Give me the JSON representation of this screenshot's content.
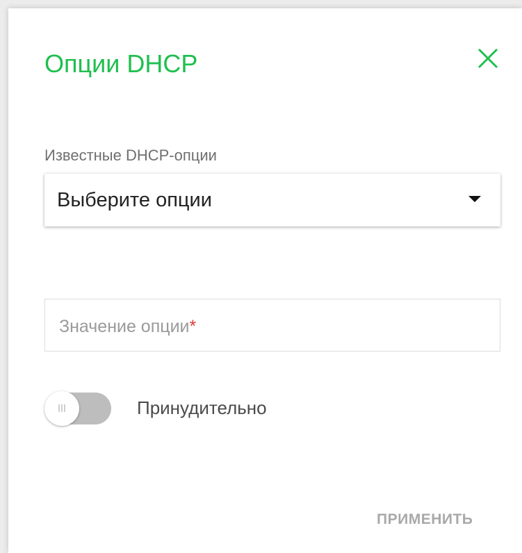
{
  "dialog": {
    "title": "Опции DHCP",
    "known_options": {
      "label": "Известные DHCP-опции",
      "selected": "Выберите опции"
    },
    "option_value": {
      "placeholder": "Значение опции",
      "required_mark": "*"
    },
    "force_toggle": {
      "label": "Принудительно",
      "enabled": false
    },
    "apply_label": "ПРИМЕНИТЬ"
  },
  "colors": {
    "accent": "#1fbf4f",
    "required": "#e53935",
    "disabled_text": "#a9a9a9"
  }
}
